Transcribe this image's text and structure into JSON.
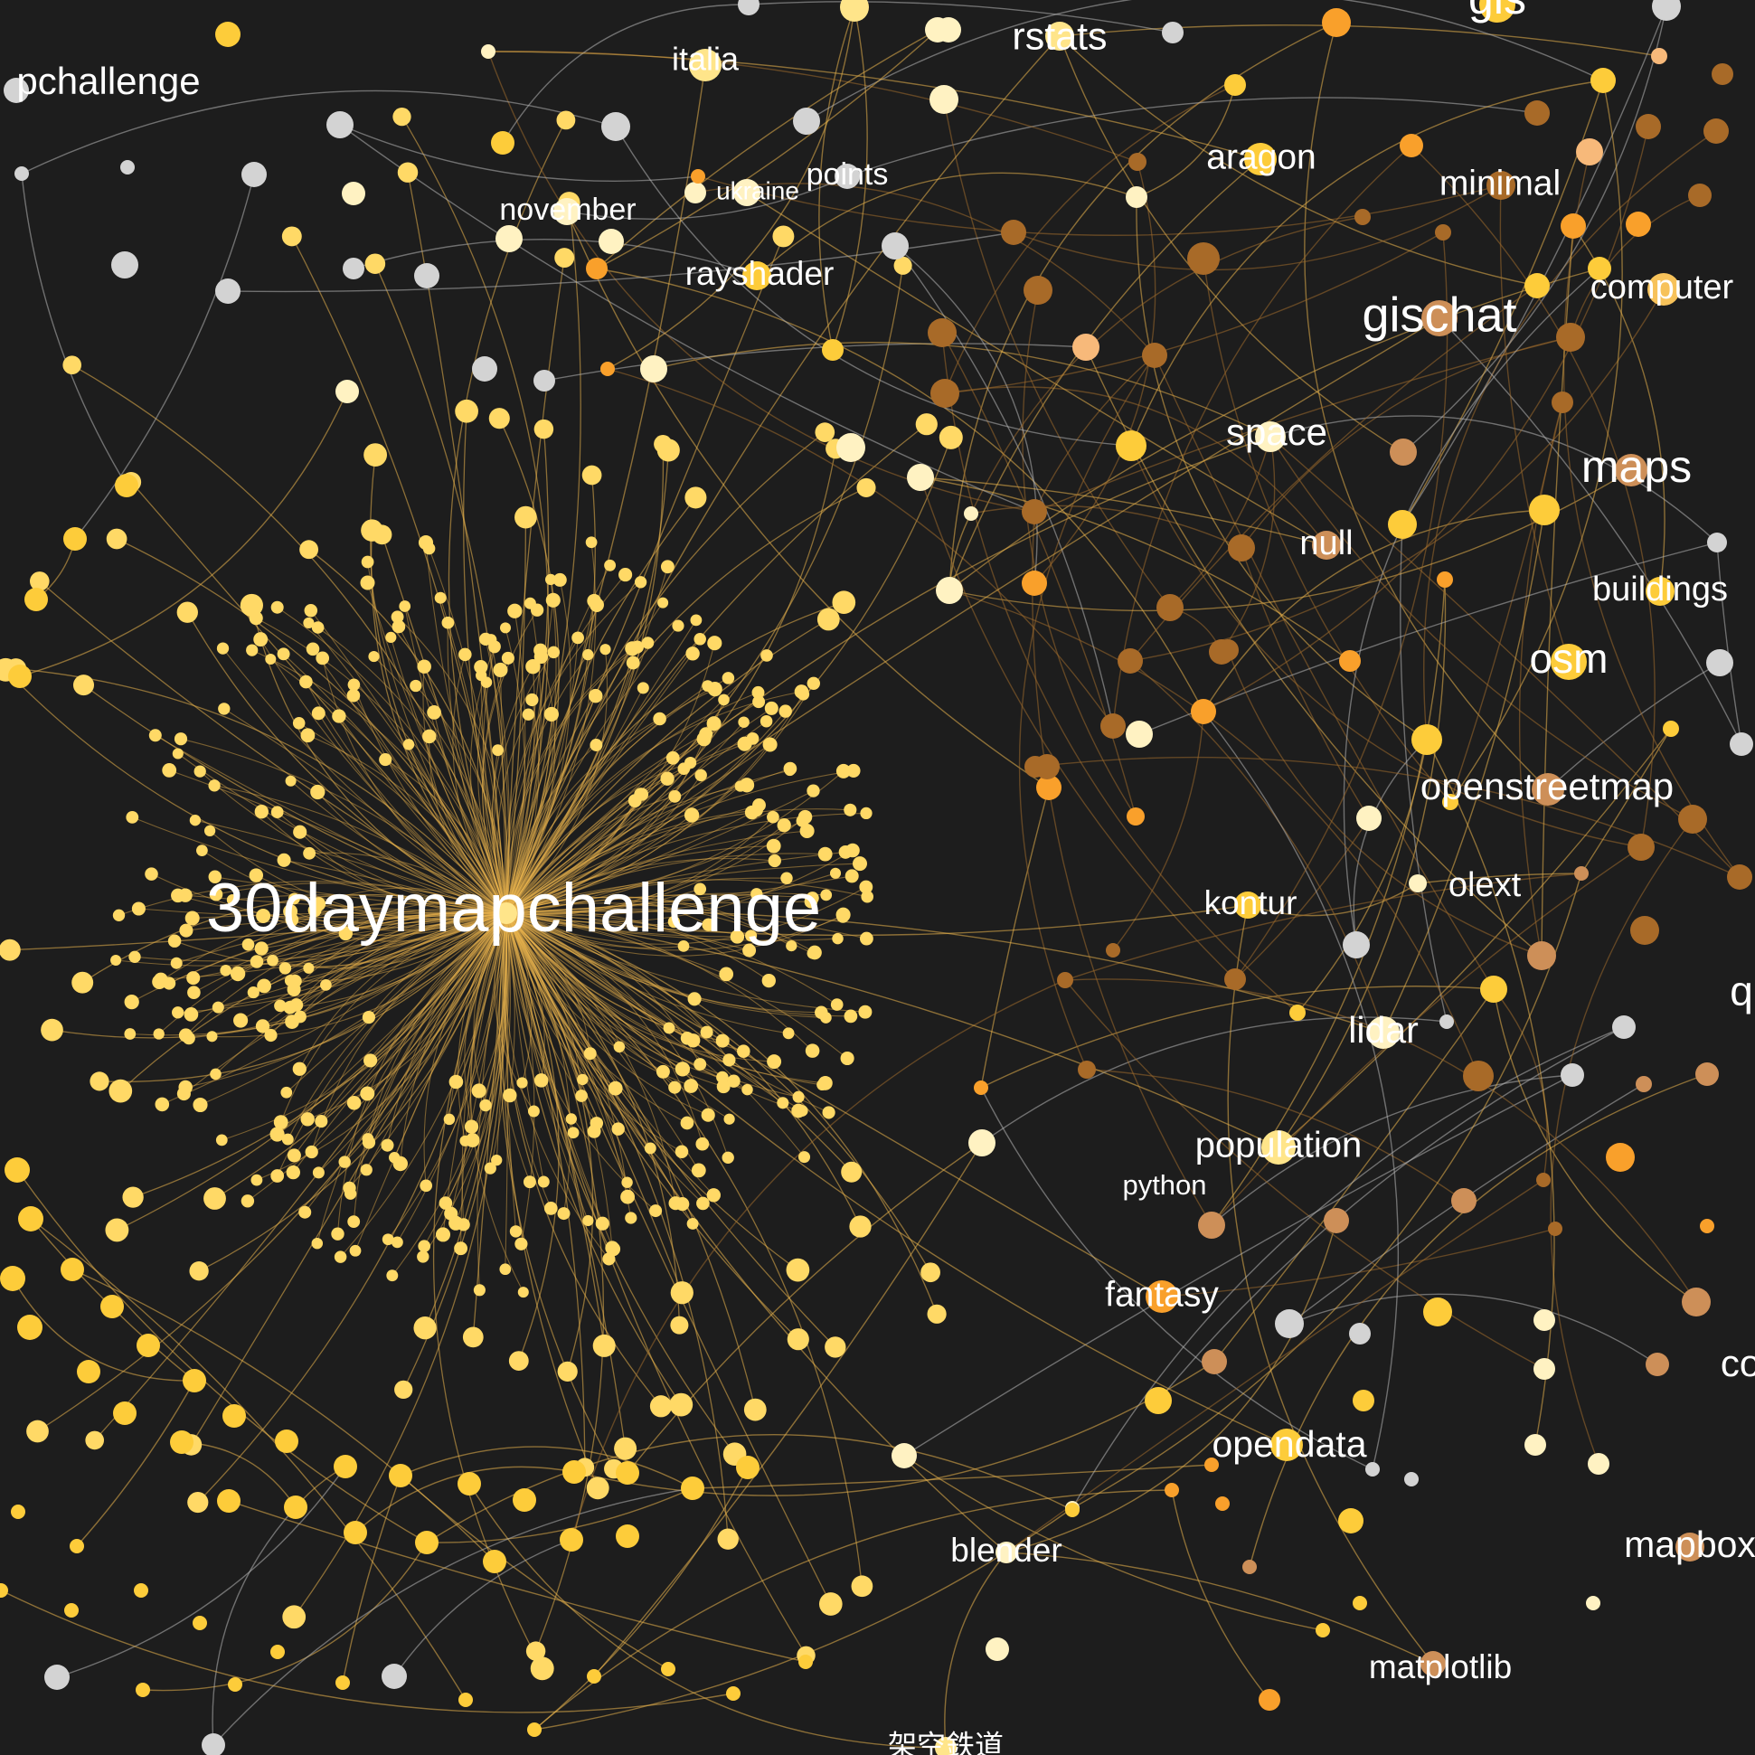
{
  "colors": {
    "background": "#1d1d1d",
    "label": "#ffffff",
    "hub": "#ffe58a",
    "leaf_yellow": "#ffd966",
    "gold": "#fdcc3a",
    "orange": "#f9a02b",
    "brown": "#a86a28",
    "tan": "#cd8f58",
    "grey": "#d3d3d3",
    "edge_gold": "#e8b24c",
    "edge_grey": "#b5b5b5",
    "edge_brown": "#9c6a2c"
  },
  "labels": {
    "hub": "30daymapchallenge",
    "partial_topleft": "pchallenge",
    "italia": "italia",
    "rstats": "rstats",
    "gis": "gis",
    "aragon": "aragon",
    "minimal": "minimal",
    "points": "points",
    "ukraine": "ukraine",
    "november": "november",
    "rayshader": "rayshader",
    "gischat": "gischat",
    "computer": "computer",
    "space": "space",
    "maps": "maps",
    "null": "null",
    "buildings": "buildings",
    "osm": "osm",
    "openstreetmap": "openstreetmap",
    "kontur": "kontur",
    "olext": "olext",
    "lidar": "lidar",
    "q_partial": "q",
    "population": "population",
    "python": "python",
    "fantasy": "fantasy",
    "co_partial": "co",
    "opendata": "opendata",
    "mapbox_partial": "mapbox",
    "blender": "blender",
    "matplotlib": "matplotlib",
    "kuusou_tetsudou": "架空鉄道"
  }
}
